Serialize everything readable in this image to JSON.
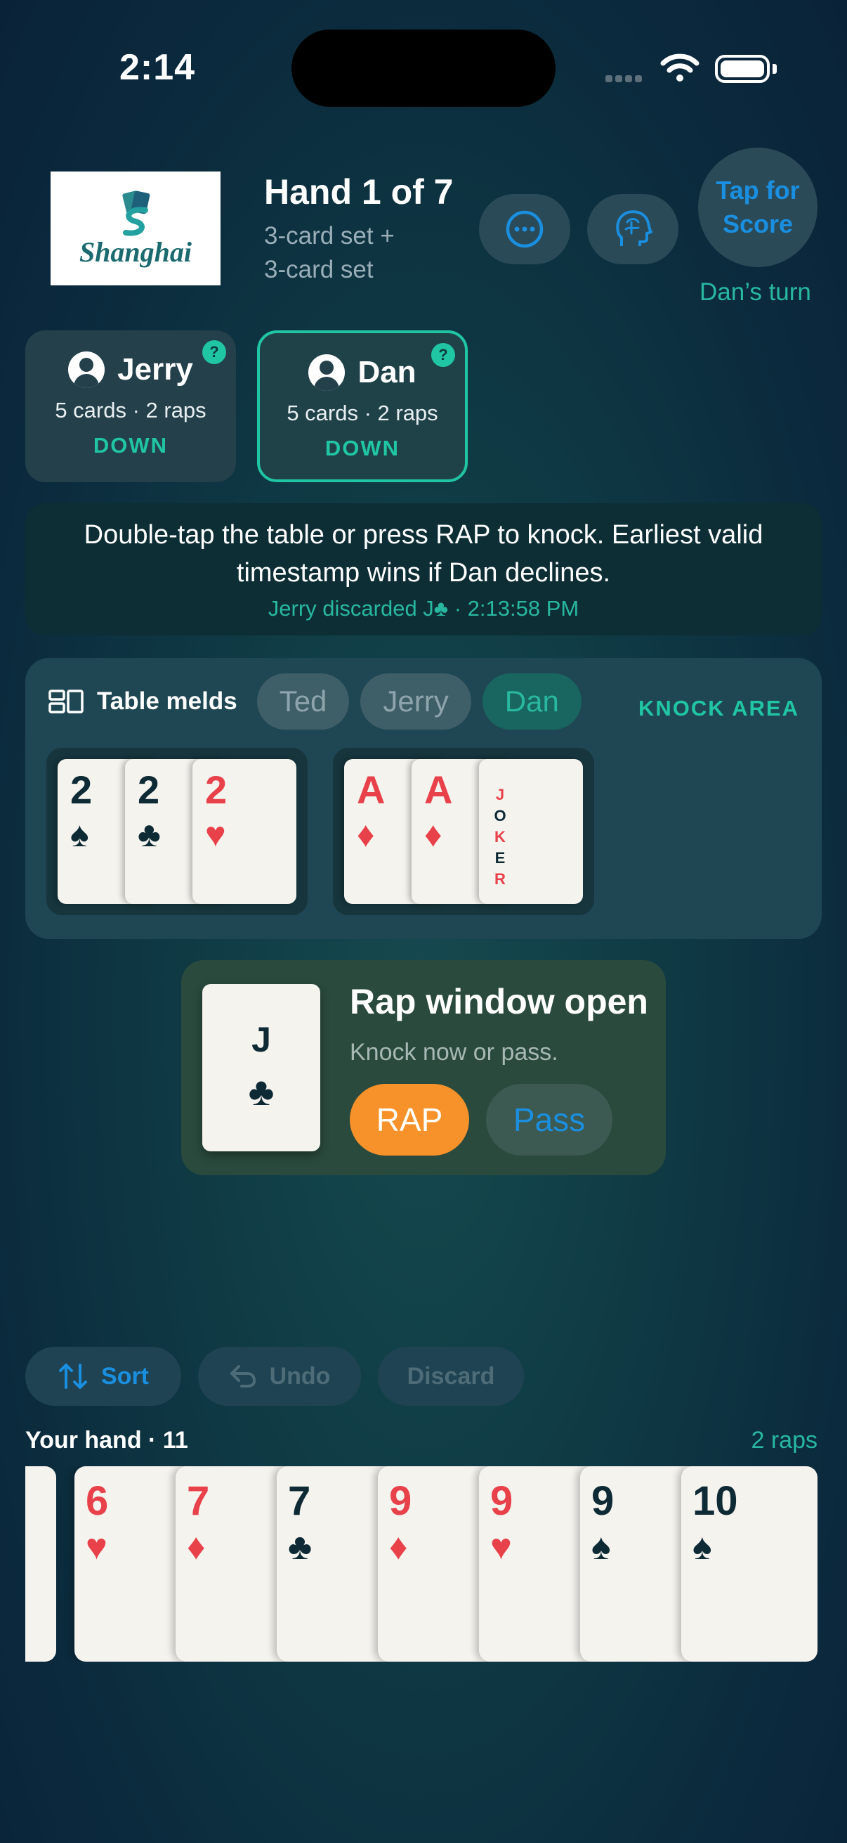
{
  "status_bar": {
    "time": "2:14"
  },
  "header": {
    "logo_text": "Shanghai",
    "hand_title": "Hand 1 of 7",
    "hand_sub_1": "3-card set +",
    "hand_sub_2": "3-card set",
    "score_button": "Tap for Score",
    "turn_text": "Dan’s turn",
    "more_icon": "ellipsis-circle-icon",
    "brain_icon": "brain-head-icon"
  },
  "players": [
    {
      "name": "Jerry",
      "stats": "5 cards · 2 raps",
      "status": "DOWN",
      "badge": "?",
      "active": false
    },
    {
      "name": "Dan",
      "stats": "5 cards · 2 raps",
      "status": "DOWN",
      "badge": "?",
      "active": true
    }
  ],
  "banner": {
    "message": "Double-tap the table or press RAP to knock. Earliest valid timestamp wins if Dan declines.",
    "sub": "Jerry discarded J♣ · 2:13:58 PM"
  },
  "table_melds": {
    "title": "Table melds",
    "tabs": [
      "Ted",
      "Jerry",
      "Dan"
    ],
    "selected_tab": "Dan",
    "knock_area": "KNOCK AREA",
    "groups": [
      [
        {
          "rank": "2",
          "suit": "♠",
          "color": "black"
        },
        {
          "rank": "2",
          "suit": "♣",
          "color": "black"
        },
        {
          "rank": "2",
          "suit": "♥",
          "color": "red"
        }
      ],
      [
        {
          "rank": "A",
          "suit": "♦",
          "color": "red"
        },
        {
          "rank": "A",
          "suit": "♦",
          "color": "red"
        },
        {
          "rank": "JOKER",
          "suit": "",
          "color": "joker"
        }
      ]
    ]
  },
  "rap_window": {
    "card_rank": "J",
    "card_suit": "♣",
    "title": "Rap window open",
    "sub": "Knock now or pass.",
    "rap_label": "RAP",
    "pass_label": "Pass"
  },
  "toolbar": {
    "sort": "Sort",
    "undo": "Undo",
    "discard": "Discard"
  },
  "hand": {
    "label": "Your hand · 11",
    "raps": "2 raps",
    "cards": [
      {
        "rank": "",
        "suit": "",
        "color": "black"
      },
      {
        "rank": "6",
        "suit": "♥",
        "color": "red"
      },
      {
        "rank": "7",
        "suit": "♦",
        "color": "red"
      },
      {
        "rank": "7",
        "suit": "♣",
        "color": "black"
      },
      {
        "rank": "9",
        "suit": "♦",
        "color": "red"
      },
      {
        "rank": "9",
        "suit": "♥",
        "color": "red"
      },
      {
        "rank": "9",
        "suit": "♠",
        "color": "black"
      },
      {
        "rank": "10",
        "suit": "♠",
        "color": "black"
      }
    ]
  },
  "colors": {
    "accent_teal": "#20c6a4",
    "accent_blue": "#1a8fe0",
    "rap_orange": "#f7922a",
    "card_red": "#e8414a"
  }
}
